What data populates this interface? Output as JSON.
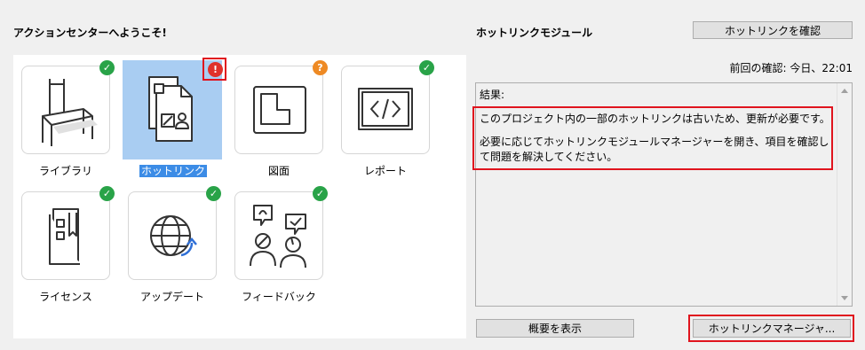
{
  "left": {
    "heading": "アクションセンターへようこそ!",
    "tiles": [
      {
        "label": "ライブラリ",
        "icon": "chair-icon",
        "status": "ok"
      },
      {
        "label": "ホットリンク",
        "icon": "hotlink-document-icon",
        "status": "error",
        "selected": true
      },
      {
        "label": "図面",
        "icon": "drawing-sheet-icon",
        "status": "warning"
      },
      {
        "label": "レポート",
        "icon": "code-report-icon",
        "status": "ok"
      },
      {
        "label": "ライセンス",
        "icon": "license-book-icon",
        "status": "ok"
      },
      {
        "label": "アップデート",
        "icon": "globe-update-icon",
        "status": "ok"
      },
      {
        "label": "フィードバック",
        "icon": "feedback-people-icon",
        "status": "ok"
      }
    ],
    "badges": {
      "ok": "✓",
      "warning": "?",
      "error": "!"
    }
  },
  "right": {
    "heading": "ホットリンクモジュール",
    "check_button": "ホットリンクを確認",
    "last_check": "前回の確認: 今日、22:01",
    "result_label": "結果:",
    "result_line1": "このプロジェクト内の一部のホットリンクは古いため、更新が必要です。",
    "result_line2": "必要に応じてホットリンクモジュールマネージャーを開き、項目を確認して問題を解決してください。",
    "summary_button": "概要を表示",
    "manager_button": "ホットリンクマネージャ..."
  },
  "colors": {
    "ok": "#29a348",
    "warning": "#ee8a24",
    "error": "#e0312b",
    "highlight": "#e0141e",
    "selection": "#a9cdf2"
  }
}
